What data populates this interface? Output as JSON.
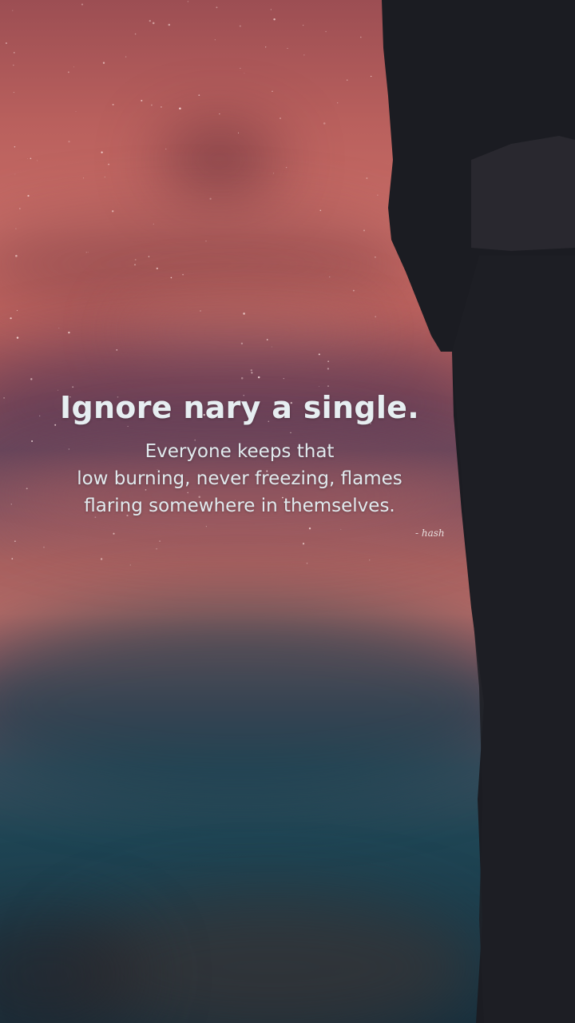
{
  "quote": {
    "headline": "Ignore nary a single.",
    "lines": [
      "Everyone keeps that",
      "low burning, never freezing, flames",
      "flaring somewhere in themselves."
    ],
    "signature": "- hash"
  },
  "colors": {
    "sky_top": "#9c4e53",
    "sky_glow": "#c76c66",
    "haze": "#6e4a5c",
    "ground_teal": "#1f4554",
    "silhouette": "#1b1d24",
    "text": "#e3ecef"
  }
}
